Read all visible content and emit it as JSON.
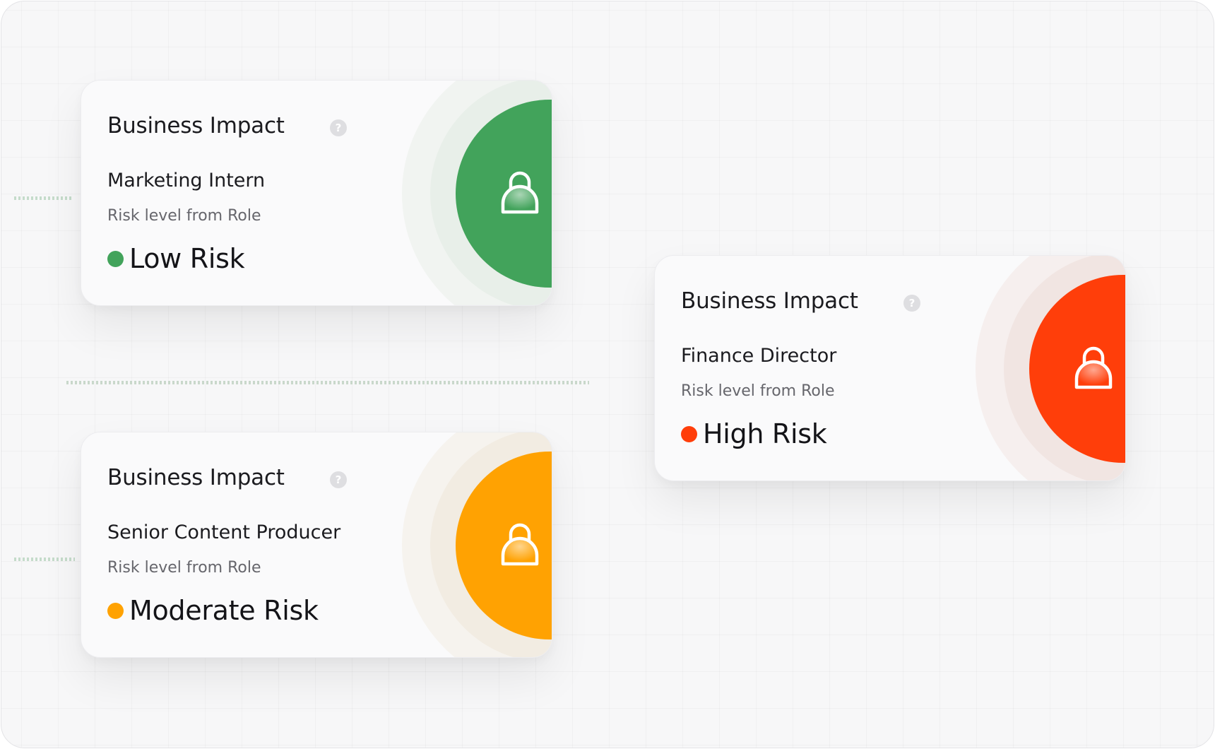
{
  "cards": [
    {
      "title": "Business Impact",
      "help": "?",
      "role": "Marketing Intern",
      "subtitle": "Risk level from Role",
      "risk": "Low Risk",
      "color": "#42a35b"
    },
    {
      "title": "Business Impact",
      "help": "?",
      "role": "Finance Director",
      "subtitle": "Risk level from Role",
      "risk": "High Risk",
      "color": "#ff3e0a"
    },
    {
      "title": "Business Impact",
      "help": "?",
      "role": "Senior Content Producer",
      "subtitle": "Risk level from Role",
      "risk": "Moderate Risk",
      "color": "#ffa202"
    }
  ]
}
